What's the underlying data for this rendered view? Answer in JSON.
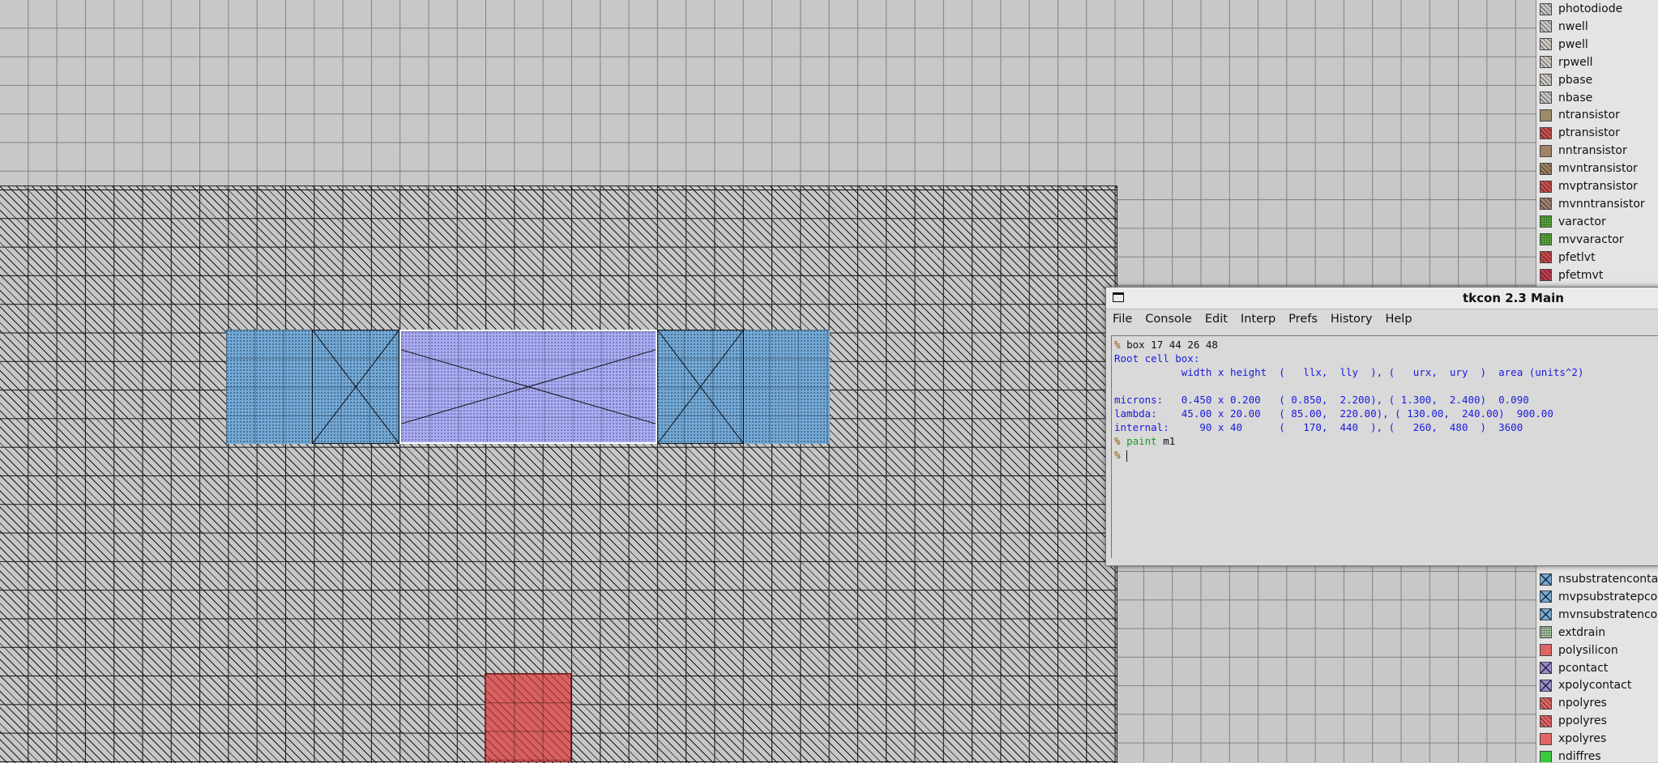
{
  "palette": {
    "top_layers": [
      {
        "label": "photodiode",
        "color": "#c8c8c8",
        "pattern": "hatch"
      },
      {
        "label": "nwell",
        "color": "#c8c8c8",
        "pattern": "hatch"
      },
      {
        "label": "pwell",
        "color": "#cfcac2",
        "pattern": "hatch"
      },
      {
        "label": "rpwell",
        "color": "#cfcac2",
        "pattern": "hatch"
      },
      {
        "label": "pbase",
        "color": "#cfcac2",
        "pattern": "hatch"
      },
      {
        "label": "nbase",
        "color": "#c8c8c8",
        "pattern": "hatch"
      },
      {
        "label": "ntransistor",
        "color": "#9c8a6a",
        "pattern": "solid"
      },
      {
        "label": "ptransistor",
        "color": "#c85050",
        "pattern": "hatch"
      },
      {
        "label": "nntransistor",
        "color": "#a08266",
        "pattern": "solid"
      },
      {
        "label": "mvntransistor",
        "color": "#9c8060",
        "pattern": "hatch"
      },
      {
        "label": "mvptransistor",
        "color": "#c85050",
        "pattern": "hatch"
      },
      {
        "label": "mvnntransistor",
        "color": "#a08070",
        "pattern": "hatch"
      },
      {
        "label": "varactor",
        "color": "#5cb03c",
        "pattern": "dots"
      },
      {
        "label": "mvvaractor",
        "color": "#5cb03c",
        "pattern": "dots"
      },
      {
        "label": "pfetlvt",
        "color": "#c84848",
        "pattern": "hatch"
      },
      {
        "label": "pfetmvt",
        "color": "#c03c50",
        "pattern": "hatch"
      }
    ],
    "bottom_layers": [
      {
        "label": "nsubstratencontact",
        "color": "#74a9d6",
        "pattern": "x"
      },
      {
        "label": "mvpsubstratepcontact",
        "color": "#74a9d6",
        "pattern": "x"
      },
      {
        "label": "mvnsubstratencontact",
        "color": "#74a9d6",
        "pattern": "x"
      },
      {
        "label": "extdrain",
        "color": "#a8c8a0",
        "pattern": "dots"
      },
      {
        "label": "polysilicon",
        "color": "#e06464",
        "pattern": "solid"
      },
      {
        "label": "pcontact",
        "color": "#9a8ad0",
        "pattern": "x"
      },
      {
        "label": "xpolycontact",
        "color": "#9a8ad0",
        "pattern": "x"
      },
      {
        "label": "npolyres",
        "color": "#e06464",
        "pattern": "hatch"
      },
      {
        "label": "ppolyres",
        "color": "#e06464",
        "pattern": "hatch"
      },
      {
        "label": "xpolyres",
        "color": "#e06464",
        "pattern": "solid"
      },
      {
        "label": "ndiffres",
        "color": "#3cc83c",
        "pattern": "solid"
      }
    ]
  },
  "tkcon": {
    "title": "tkcon 2.3 Main",
    "menu": [
      "File",
      "Console",
      "Edit",
      "Interp",
      "Prefs",
      "History",
      "Help"
    ],
    "lines": [
      [
        {
          "t": "% ",
          "c": "prompt"
        },
        {
          "t": "box 17 44 26 48",
          "c": "plain"
        }
      ],
      [
        {
          "t": "Root cell box:",
          "c": "blue"
        }
      ],
      [
        {
          "t": "           width x height  (   llx,  lly  ), (   urx,  ury  )  area (units^2)",
          "c": "blue"
        }
      ],
      [
        {
          "t": "",
          "c": "blue"
        }
      ],
      [
        {
          "t": "microns:   0.450 x 0.200   ( 0.850,  2.200), ( 1.300,  2.400)  0.090",
          "c": "blue"
        }
      ],
      [
        {
          "t": "lambda:    45.00 x 20.00   ( 85.00,  220.00), ( 130.00,  240.00)  900.00",
          "c": "blue"
        }
      ],
      [
        {
          "t": "internal:     90 x 40      (   170,  440  ), (   260,  480  )  3600",
          "c": "blue"
        }
      ],
      [
        {
          "t": "% ",
          "c": "prompt"
        },
        {
          "t": "paint",
          "c": "cmd"
        },
        {
          "t": " m1",
          "c": "plain"
        }
      ],
      [
        {
          "t": "% ",
          "c": "prompt"
        },
        {
          "t": "",
          "c": "plain",
          "cursor": true
        }
      ]
    ]
  }
}
